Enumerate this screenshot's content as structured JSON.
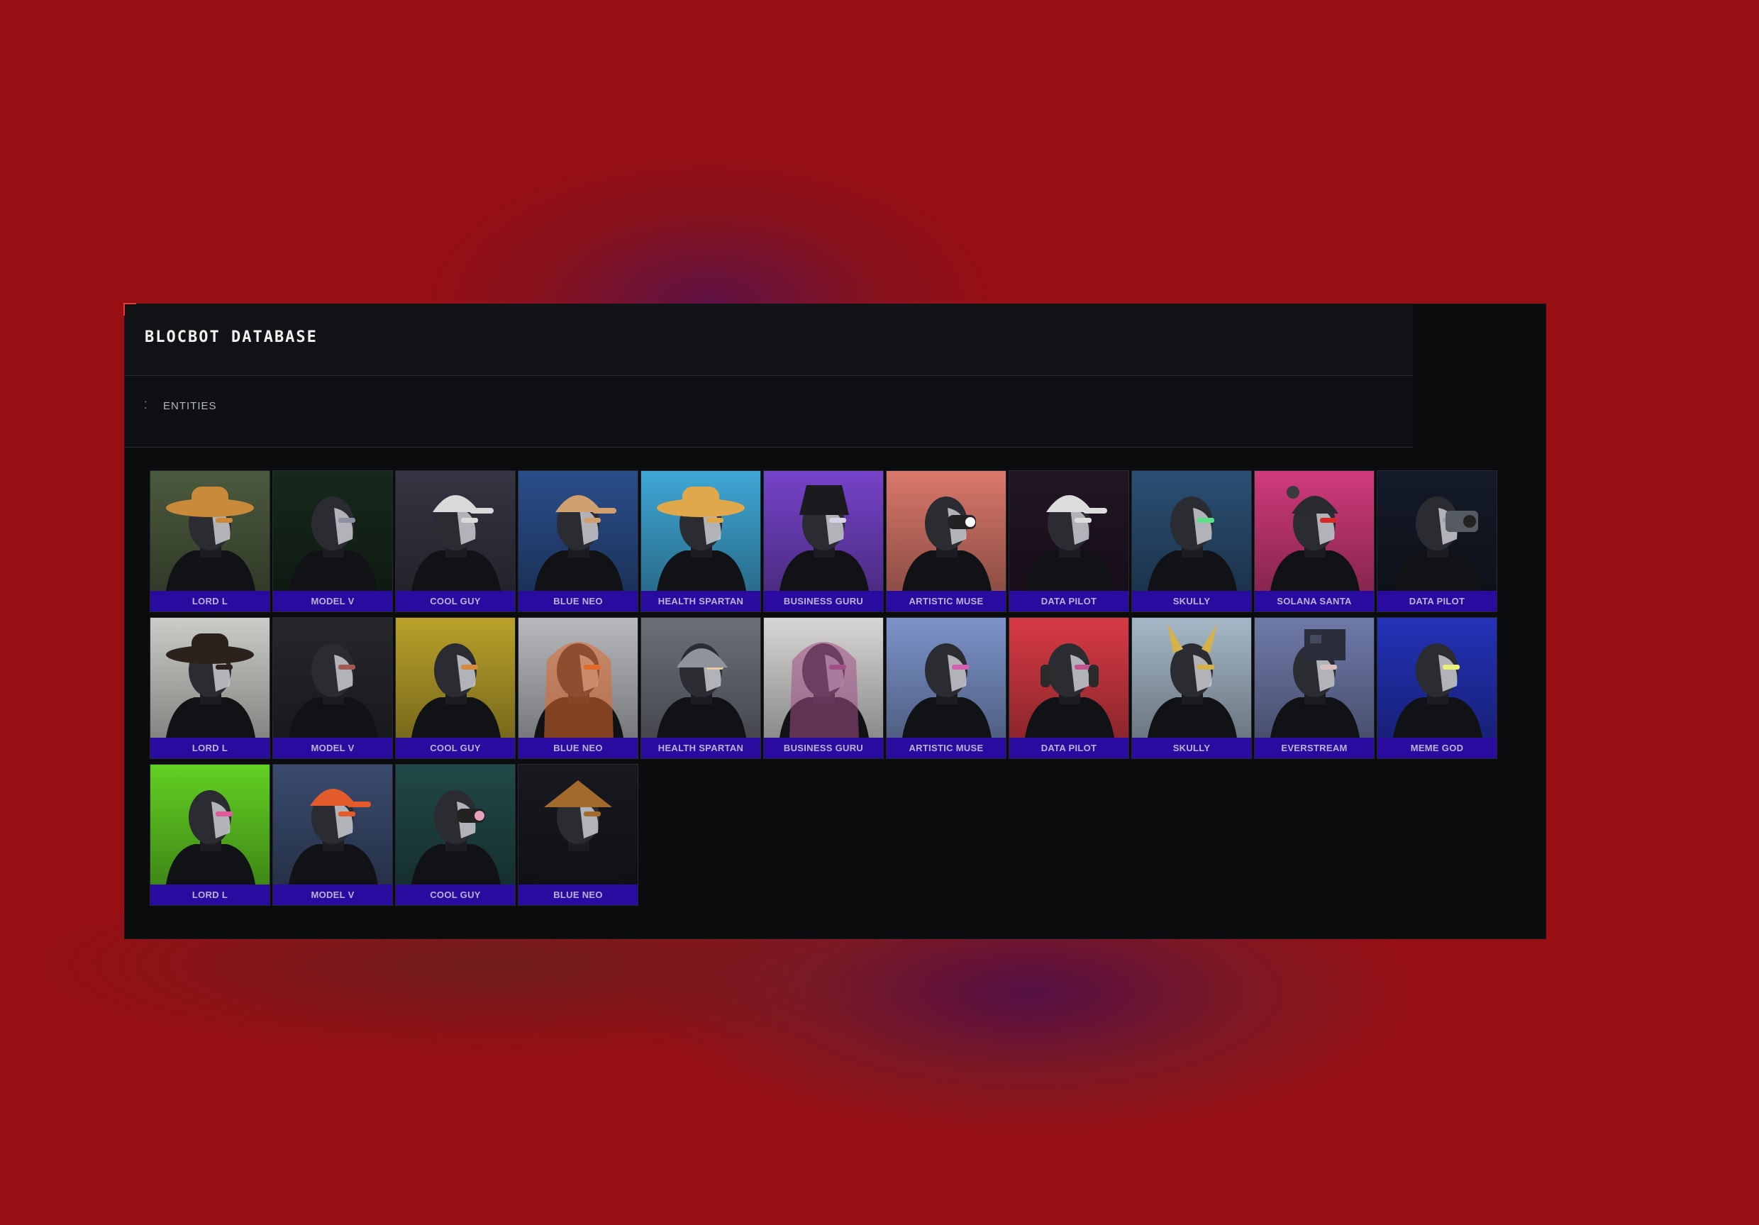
{
  "app": {
    "title": "BLOCBOT DATABASE"
  },
  "section": {
    "label": "ENTITIES",
    "menu_icon": "dots-icon"
  },
  "entities": [
    {
      "name": "LORD L",
      "bg": "#4b5a3e",
      "accent": "#c98a3a",
      "headwear": "brim-hat"
    },
    {
      "name": "MODEL V",
      "bg": "#16281b",
      "accent": "#8d8fa3",
      "headwear": "none"
    },
    {
      "name": "COOL GUY",
      "bg": "#353543",
      "accent": "#d9d9d9",
      "headwear": "cap"
    },
    {
      "name": "BLUE NEO",
      "bg": "#2a4d8a",
      "accent": "#d0a070",
      "headwear": "cap"
    },
    {
      "name": "HEALTH SPARTAN",
      "bg": "#3fa7d6",
      "accent": "#e1a74b",
      "headwear": "brim-hat"
    },
    {
      "name": "BUSINESS GURU",
      "bg": "#7543c9",
      "accent": "#d7d0e6",
      "headwear": "bucket"
    },
    {
      "name": "ARTISTIC MUSE",
      "bg": "#d9786a",
      "accent": "#ffffff",
      "headwear": "goggles"
    },
    {
      "name": "DATA PILOT",
      "bg": "#221524",
      "accent": "#dcdcdc",
      "headwear": "cap"
    },
    {
      "name": "SKULLY",
      "bg": "#2b4f74",
      "accent": "#5ee08a",
      "headwear": "none"
    },
    {
      "name": "SOLANA SANTA",
      "bg": "#d03a7b",
      "accent": "#d62b2b",
      "headwear": "beanie"
    },
    {
      "name": "DATA PILOT",
      "bg": "#141a28",
      "accent": "#9aa0a8",
      "headwear": "camera"
    },
    {
      "name": "LORD L",
      "bg": "#c9ccc7",
      "accent": "#2a221b",
      "headwear": "cowboy"
    },
    {
      "name": "MODEL V",
      "bg": "#26272b",
      "accent": "#a45a54",
      "headwear": "none"
    },
    {
      "name": "COOL GUY",
      "bg": "#b9a12a",
      "accent": "#d58b3b",
      "headwear": "none"
    },
    {
      "name": "BLUE NEO",
      "bg": "#b7b9bd",
      "accent": "#e06a2c",
      "headwear": "hood"
    },
    {
      "name": "HEALTH SPARTAN",
      "bg": "#6c6f78",
      "accent": "#e7c8a0",
      "headwear": "helmet"
    },
    {
      "name": "BUSINESS GURU",
      "bg": "#d7d6d4",
      "accent": "#a34e86",
      "headwear": "hood"
    },
    {
      "name": "ARTISTIC MUSE",
      "bg": "#7b93c9",
      "accent": "#d65fb0",
      "headwear": "none"
    },
    {
      "name": "DATA PILOT",
      "bg": "#d83a44",
      "accent": "#c55393",
      "headwear": "headphones"
    },
    {
      "name": "SKULLY",
      "bg": "#a5b7c6",
      "accent": "#d4b24a",
      "headwear": "horns"
    },
    {
      "name": "EVERSTREAM",
      "bg": "#6f7aa9",
      "accent": "#d8c0c0",
      "headwear": "box"
    },
    {
      "name": "MEME GOD",
      "bg": "#2332b8",
      "accent": "#e9f07b",
      "headwear": "none"
    },
    {
      "name": "LORD L",
      "bg": "#62d022",
      "accent": "#e25a9a",
      "headwear": "none"
    },
    {
      "name": "MODEL V",
      "bg": "#3a4b6e",
      "accent": "#e35b2b",
      "headwear": "propeller-cap"
    },
    {
      "name": "COOL GUY",
      "bg": "#214848",
      "accent": "#e7a3b9",
      "headwear": "goggles"
    },
    {
      "name": "BLUE NEO",
      "bg": "#18191f",
      "accent": "#a36a2e",
      "headwear": "conical-hat"
    }
  ]
}
